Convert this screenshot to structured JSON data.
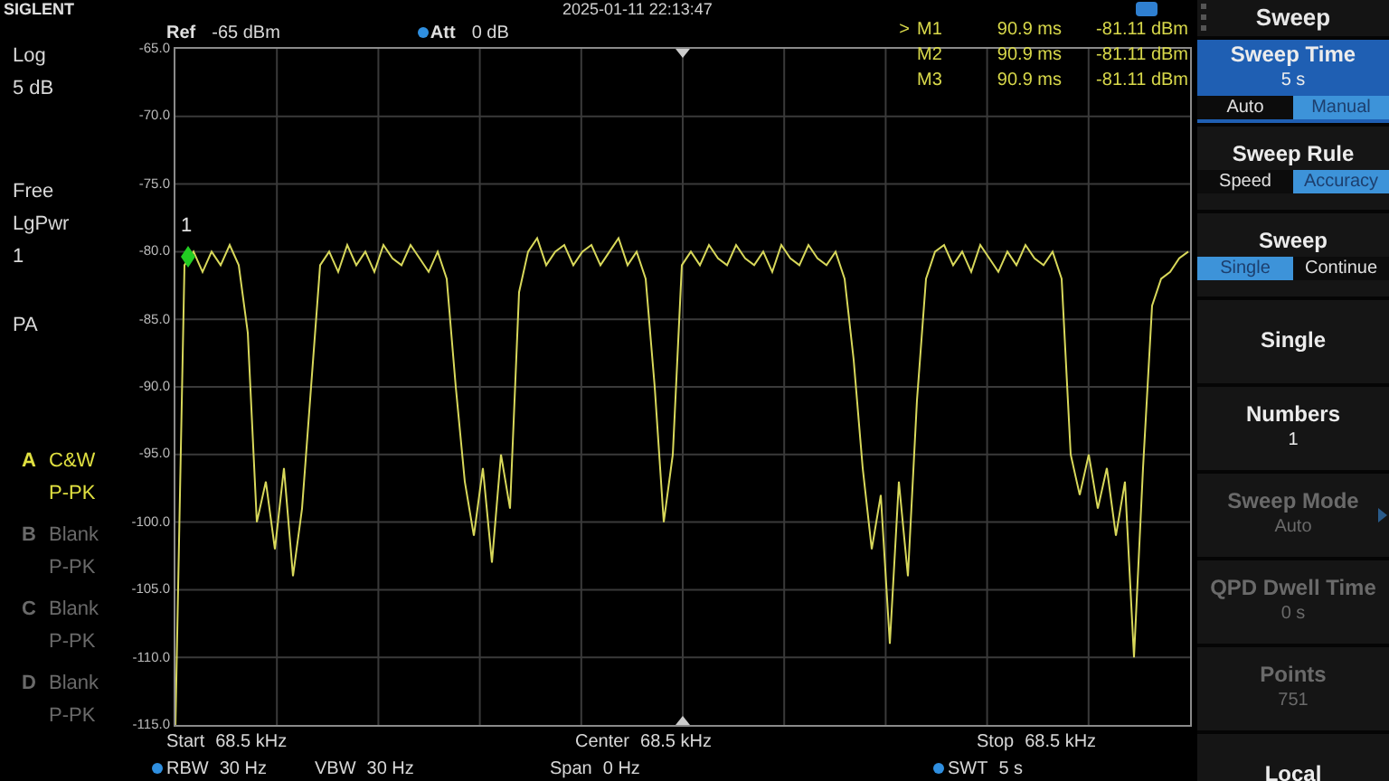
{
  "top_bar": {
    "logo": "SIGLENT",
    "datetime": "2025-01-11 22:13:47"
  },
  "left_panel": {
    "groups": [
      [
        "Log",
        "5 dB"
      ],
      [
        "Free",
        "LgPwr",
        "1"
      ],
      [
        "PA"
      ]
    ]
  },
  "traces": [
    {
      "letter": "A",
      "mode": "C&W",
      "detector": "P-PK",
      "active": true
    },
    {
      "letter": "B",
      "mode": "Blank",
      "detector": "P-PK",
      "active": false
    },
    {
      "letter": "C",
      "mode": "Blank",
      "detector": "P-PK",
      "active": false
    },
    {
      "letter": "D",
      "mode": "Blank",
      "detector": "P-PK",
      "active": false
    }
  ],
  "header": {
    "ref_label": "Ref",
    "ref_value": "-65 dBm",
    "att_label": "Att",
    "att_value": "0 dB"
  },
  "markers": [
    {
      "prefix": ">",
      "name": "M1",
      "time": "90.9 ms",
      "level": "-81.11 dBm"
    },
    {
      "name": "M2",
      "time": "90.9 ms",
      "level": "-81.11 dBm"
    },
    {
      "name": "M3",
      "time": "90.9 ms",
      "level": "-81.11 dBm"
    }
  ],
  "plot": {
    "marker_label": "1",
    "chart_data": {
      "type": "line",
      "grid": true,
      "ylim": [
        -115,
        -65
      ],
      "yticks": [
        {
          "value": -65,
          "label": "-65.0"
        },
        {
          "value": -70,
          "label": "-70.0"
        },
        {
          "value": -75,
          "label": "-75.0"
        },
        {
          "value": -80,
          "label": "-80.0"
        },
        {
          "value": -85,
          "label": "-85.0"
        },
        {
          "value": -90,
          "label": "-90.0"
        },
        {
          "value": -95,
          "label": "-95.0"
        },
        {
          "value": -100,
          "label": "-100.0"
        },
        {
          "value": -105,
          "label": "-105.0"
        },
        {
          "value": -110,
          "label": "-110.0"
        },
        {
          "value": -115,
          "label": "-115.0"
        }
      ],
      "series": [
        {
          "color": "#d8d85a",
          "values": [
            -115,
            -81,
            -80,
            -81.5,
            -80,
            -81,
            -79.5,
            -81,
            -86,
            -100,
            -97,
            -102,
            -96,
            -104,
            -99,
            -90,
            -81,
            -80,
            -81.5,
            -79.5,
            -81,
            -80,
            -81.5,
            -79.5,
            -80.5,
            -81,
            -79.5,
            -80.5,
            -81.5,
            -80,
            -82,
            -90,
            -97,
            -101,
            -96,
            -103,
            -95,
            -99,
            -83,
            -80,
            -79,
            -81,
            -80,
            -79.5,
            -81,
            -80,
            -79.5,
            -81,
            -80,
            -79,
            -81,
            -80,
            -82,
            -90,
            -100,
            -95,
            -81,
            -80,
            -81,
            -79.5,
            -80.5,
            -81,
            -79.5,
            -80.5,
            -81,
            -80,
            -81.5,
            -79.5,
            -80.5,
            -81,
            -79.5,
            -80.5,
            -81,
            -80,
            -82,
            -88,
            -96,
            -102,
            -98,
            -109,
            -97,
            -104,
            -91,
            -82,
            -80,
            -79.5,
            -81,
            -80,
            -81.5,
            -79.5,
            -80.5,
            -81.5,
            -80,
            -81,
            -79.5,
            -80.5,
            -81,
            -80,
            -82,
            -95,
            -98,
            -95,
            -99,
            -96,
            -101,
            -97,
            -110,
            -96,
            -84,
            -82,
            -81.5,
            -80.5,
            -80
          ]
        }
      ]
    }
  },
  "frequency_bar": [
    {
      "label": "Start",
      "value": "68.5 kHz"
    },
    {
      "label": "Center",
      "value": "68.5 kHz"
    },
    {
      "label": "Stop",
      "value": "68.5 kHz"
    }
  ],
  "bandwidth_bar": [
    {
      "label": "RBW",
      "value": "30 Hz",
      "dot": true
    },
    {
      "label": "VBW",
      "value": "30 Hz",
      "dot": false
    },
    {
      "label": "Span",
      "value": "0 Hz",
      "dot": false
    },
    {
      "label": "SWT",
      "value": "5 s",
      "dot": true
    }
  ],
  "softkeys": [
    {
      "kind": "header",
      "label": "Sweep"
    },
    {
      "kind": "key",
      "label": "Sweep Time",
      "value": "5 s",
      "highlighted": true,
      "disabled": false,
      "options": [
        {
          "label": "Auto",
          "selected": false
        },
        {
          "label": "Manual",
          "selected": true
        }
      ]
    },
    {
      "kind": "key",
      "label": "Sweep Rule",
      "highlighted": false,
      "disabled": false,
      "options": [
        {
          "label": "Speed",
          "selected": false
        },
        {
          "label": "Accuracy",
          "selected": true
        }
      ]
    },
    {
      "kind": "key",
      "label": "Sweep",
      "highlighted": false,
      "disabled": false,
      "options": [
        {
          "label": "Single",
          "selected": true
        },
        {
          "label": "Continue",
          "selected": false
        }
      ]
    },
    {
      "kind": "key",
      "label": "Single",
      "highlighted": false,
      "disabled": false
    },
    {
      "kind": "key",
      "label": "Numbers",
      "value": "1",
      "highlighted": false,
      "disabled": false
    },
    {
      "kind": "key",
      "label": "Sweep Mode",
      "value": "Auto",
      "highlighted": false,
      "disabled": true,
      "submenu": true
    },
    {
      "kind": "key",
      "label": "QPD Dwell Time",
      "value": "0 s",
      "highlighted": false,
      "disabled": true
    },
    {
      "kind": "key",
      "label": "Points",
      "value": "751",
      "highlighted": false,
      "disabled": true
    },
    {
      "kind": "key",
      "label": "Local",
      "highlighted": false,
      "disabled": false
    }
  ]
}
